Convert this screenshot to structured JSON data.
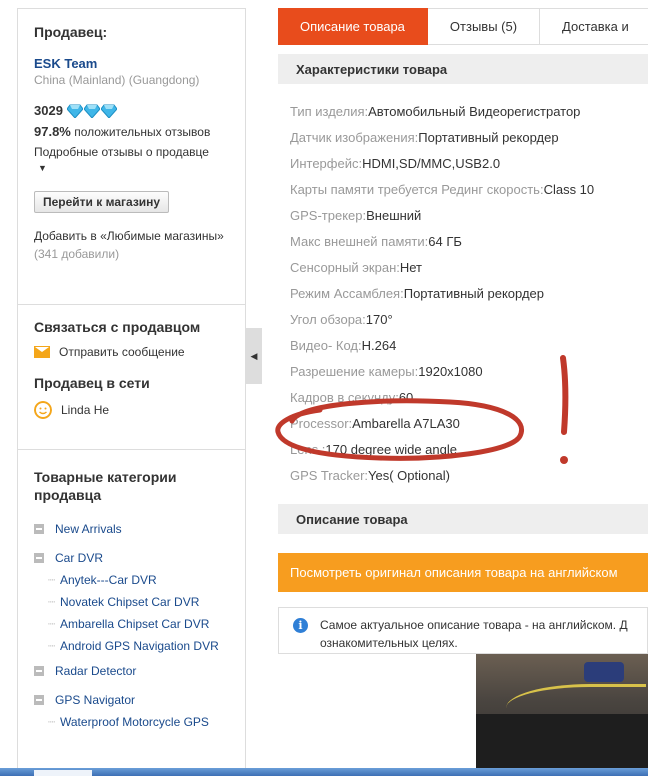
{
  "seller": {
    "heading": "Продавец:",
    "store_name": "ESK Team",
    "location": "China (Mainland) (Guangdong)",
    "rating_score": "3029",
    "diamond_count": 3,
    "feedback_percent": "97.8%",
    "feedback_text": " положительных отзывов",
    "detailed_feedback": "Подробные отзывы о продавце",
    "go_store_button": "Перейти к магазину",
    "favorites_text": "Добавить в «Любимые магазины»",
    "favorites_count": " (341 добавили)"
  },
  "contact": {
    "heading": "Связаться с продавцом",
    "send_message": "Отправить сообщение",
    "online_heading": "Продавец в сети",
    "agent_name": "Linda He"
  },
  "categories": {
    "heading": "Товарные категории продавца",
    "items": [
      {
        "label": "New Arrivals",
        "sub": []
      },
      {
        "label": "Car DVR",
        "sub": [
          "Anytek---Car DVR",
          "Novatek Chipset Car DVR",
          "Ambarella Chipset Car DVR",
          "Android GPS Navigation DVR"
        ]
      },
      {
        "label": "Radar Detector",
        "sub": []
      },
      {
        "label": "GPS Navigator",
        "sub": [
          "Waterproof Motorcycle GPS"
        ]
      }
    ]
  },
  "tabs": [
    {
      "label": "Описание товара",
      "active": true
    },
    {
      "label": "Отзывы (5)",
      "active": false
    },
    {
      "label": "Доставка и",
      "active": false
    }
  ],
  "specs_heading": "Характеристики товара",
  "specs": [
    {
      "key": "Тип изделия:",
      "value": "Автомобильный Видеорегистратор"
    },
    {
      "key": "Датчик изображения:",
      "value": "Портативный рекордер"
    },
    {
      "key": "Интерфейс:",
      "value": "HDMI,SD/MMC,USB2.0"
    },
    {
      "key": "Карты памяти требуется Рединг скорость:",
      "value": "Class 10"
    },
    {
      "key": "GPS-трекер:",
      "value": "Внешний"
    },
    {
      "key": "Макс внешней памяти:",
      "value": "64 ГБ"
    },
    {
      "key": "Сенсорный экран:",
      "value": "Нет"
    },
    {
      "key": "Режим Ассамблея:",
      "value": "Портативный рекордер"
    },
    {
      "key": "Угол обзора:",
      "value": "170°"
    },
    {
      "key": "Видео- Код:",
      "value": "H.264"
    },
    {
      "key": "Разрешение камеры:",
      "value": "1920x1080"
    },
    {
      "key": "Кадров в секунду:",
      "value": "60"
    },
    {
      "key": "Processor:",
      "value": "Ambarella A7LA30"
    },
    {
      "key": "Lens :",
      "value": "170 degree wide angle"
    },
    {
      "key": "GPS Tracker:",
      "value": "Yes( Optional)"
    }
  ],
  "description": {
    "heading": "Описание товара",
    "original_button": "Посмотреть оригинал описания товара на английском",
    "notice": "Самое актуальное описание товара - на английском. Д ознакомительных целях."
  },
  "annotation": {
    "mark": "!",
    "color": "#c0392b"
  },
  "colors": {
    "accent": "#e84c1c",
    "orange": "#f79d1f",
    "link": "#1a4a8c",
    "info": "#2f7fd6"
  }
}
